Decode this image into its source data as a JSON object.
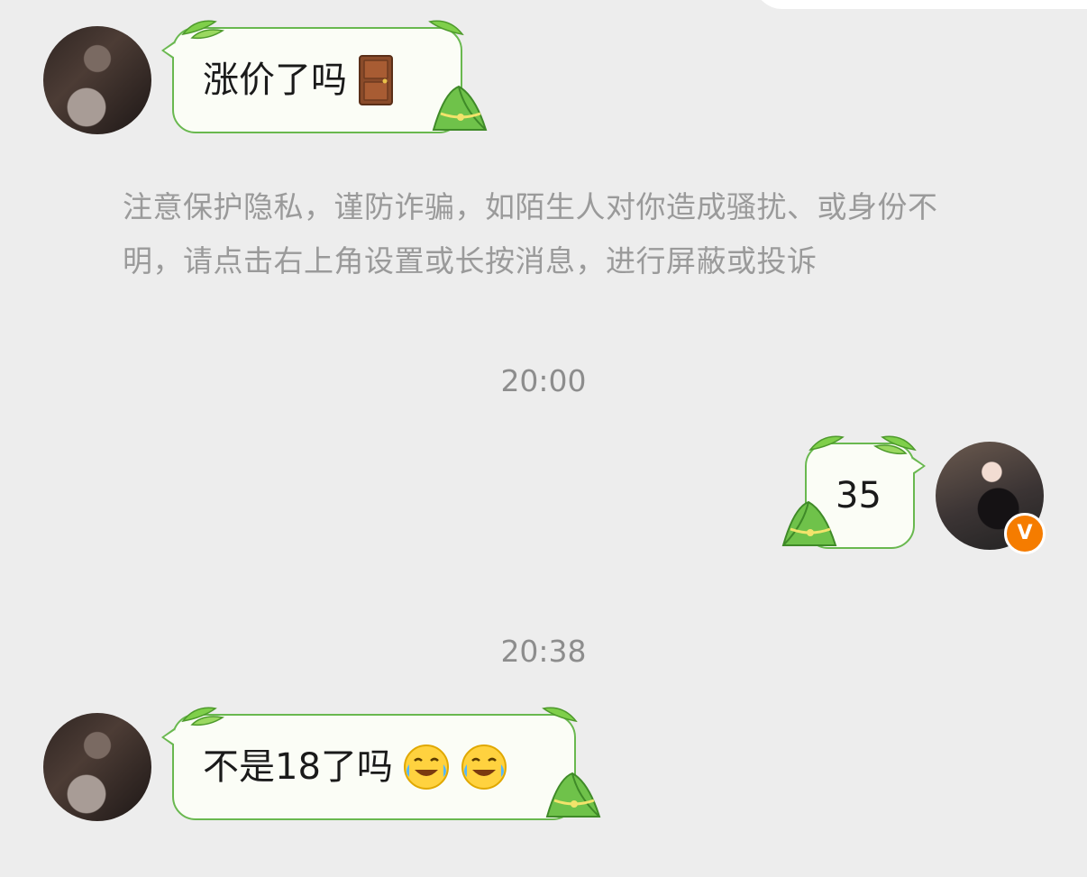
{
  "colors": {
    "background": "#ededed",
    "bubble_fill": "#fbfdf6",
    "bubble_border": "#69b84f",
    "badge": "#f57c00",
    "notice_text": "#9a9a9a",
    "timestamp_text": "#8d8d8d"
  },
  "messages": [
    {
      "sender": "other",
      "text": "涨价了吗",
      "emojis": [
        "door-icon"
      ]
    },
    {
      "sender": "self",
      "text": "35",
      "emojis": []
    },
    {
      "sender": "other",
      "text": "不是18了吗",
      "emojis": [
        "tears-of-joy-icon",
        "tears-of-joy-icon"
      ]
    }
  ],
  "notice": {
    "text": "注意保护隐私，谨防诈骗，如陌生人对你造成骚扰、或身份不明，请点击右上角设置或长按消息，进行屏蔽或投诉"
  },
  "timestamps": [
    "20:00",
    "20:38"
  ],
  "badges": {
    "verified_label": "V"
  },
  "decorations": {
    "bubble_theme": "zongzi-bamboo-leaves"
  }
}
